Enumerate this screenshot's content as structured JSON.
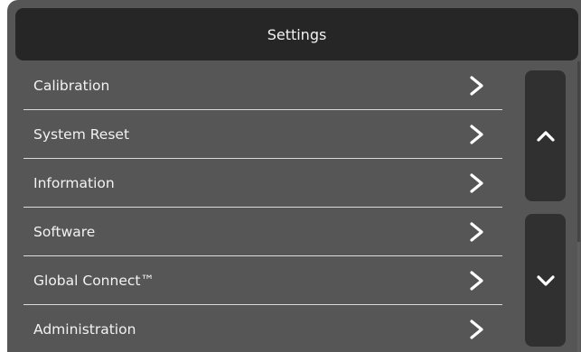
{
  "header": {
    "title": "Settings"
  },
  "menu": {
    "items": [
      {
        "label": "Calibration"
      },
      {
        "label": "System Reset"
      },
      {
        "label": "Information"
      },
      {
        "label": "Software"
      },
      {
        "label": "Global Connect™"
      },
      {
        "label": "Administration"
      }
    ],
    "item_icon": "chevron-right-icon"
  },
  "scroll": {
    "up_icon": "chevron-up-icon",
    "down_icon": "chevron-down-icon"
  },
  "colors": {
    "background": "#565656",
    "header_bg": "#262626",
    "button_bg": "#303030",
    "text": "#f2f2f2",
    "divider": "#dcdcdc"
  }
}
